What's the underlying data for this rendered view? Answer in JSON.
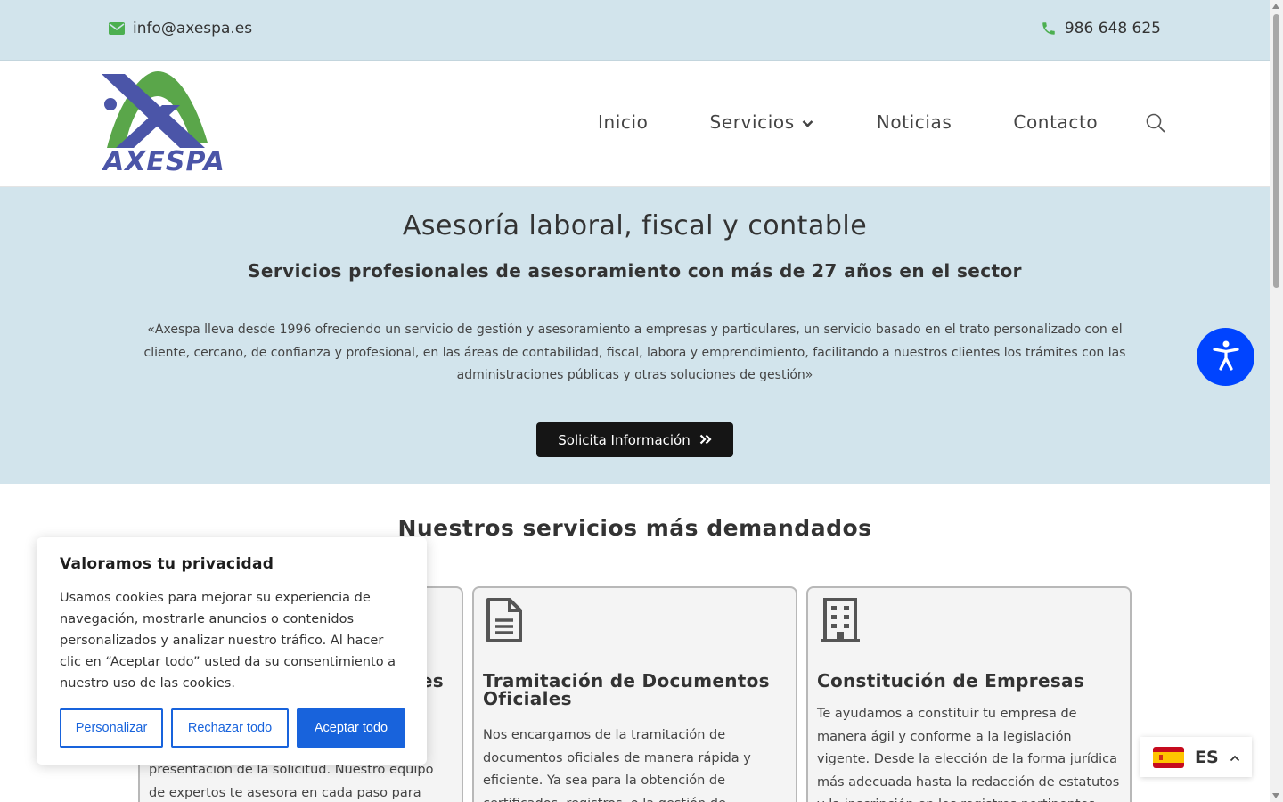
{
  "topbar": {
    "email": "info@axespa.es",
    "phone": "986 648 625",
    "email_icon": "envelope-icon",
    "phone_icon": "phone-icon"
  },
  "header": {
    "logo_text": "AXESPA",
    "nav": [
      {
        "label": "Inicio"
      },
      {
        "label": "Servicios",
        "has_dropdown": true
      },
      {
        "label": "Noticias"
      },
      {
        "label": "Contacto"
      }
    ],
    "search_icon": "search-icon"
  },
  "hero": {
    "title": "Asesoría laboral, fiscal y contable",
    "subtitle": "Servicios profesionales de asesoramiento con más de 27 años en el sector",
    "description": "«Axespa lleva desde 1996 ofreciendo un servicio de gestión y asesoramiento a empresas  y particulares, un servicio basado en el trato personalizado con el cliente, cercano, de confianza y profesional, en las áreas de contabilidad, fiscal, labora y emprendimiento, facilitando a nuestros clientes los trámites con las administraciones públicas y otras soluciones de gestión»",
    "cta_label": "Solicita Información"
  },
  "services": {
    "title": "Nuestros servicios más demandados",
    "cards": [
      {
        "icon": "hidden-icon",
        "title": "es",
        "text": "presentación de la solicitud. Nuestro equipo de expertos te asesora en cada paso para"
      },
      {
        "icon": "document-icon",
        "title": "Tramitación de Documentos Oficiales",
        "text": "Nos encargamos de la tramitación de documentos oficiales de manera rápida y eficiente. Ya sea para la obtención de certificados, registros, o la gestión de permisos"
      },
      {
        "icon": "building-icon",
        "title": "Constitución de Empresas",
        "text": "Te ayudamos a constituir tu empresa de manera ágil y conforme a la legislación vigente. Desde la elección de la forma jurídica más adecuada hasta la redacción de estatutos y la inscripción en los registros pertinentes, nuestro equipo te"
      }
    ]
  },
  "cookie": {
    "title": "Valoramos tu privacidad",
    "text": "Usamos cookies para mejorar su experiencia de navegación, mostrarle anuncios o contenidos personalizados y analizar nuestro tráfico. Al hacer clic en “Aceptar todo” usted da su consentimiento a nuestro uso de las cookies.",
    "customize_label": "Personalizar",
    "reject_label": "Rechazar todo",
    "accept_label": "Aceptar todo"
  },
  "language": {
    "code": "ES",
    "flag": "spain-flag-icon"
  },
  "colors": {
    "topbar_bg": "#d2e4ec",
    "accent_green": "#4caf50",
    "logo_blue": "#4b55a8",
    "logo_green": "#5aa64a",
    "cookie_blue": "#1863dc",
    "a11y_blue": "#0044ff",
    "cta_bg": "#151515"
  }
}
